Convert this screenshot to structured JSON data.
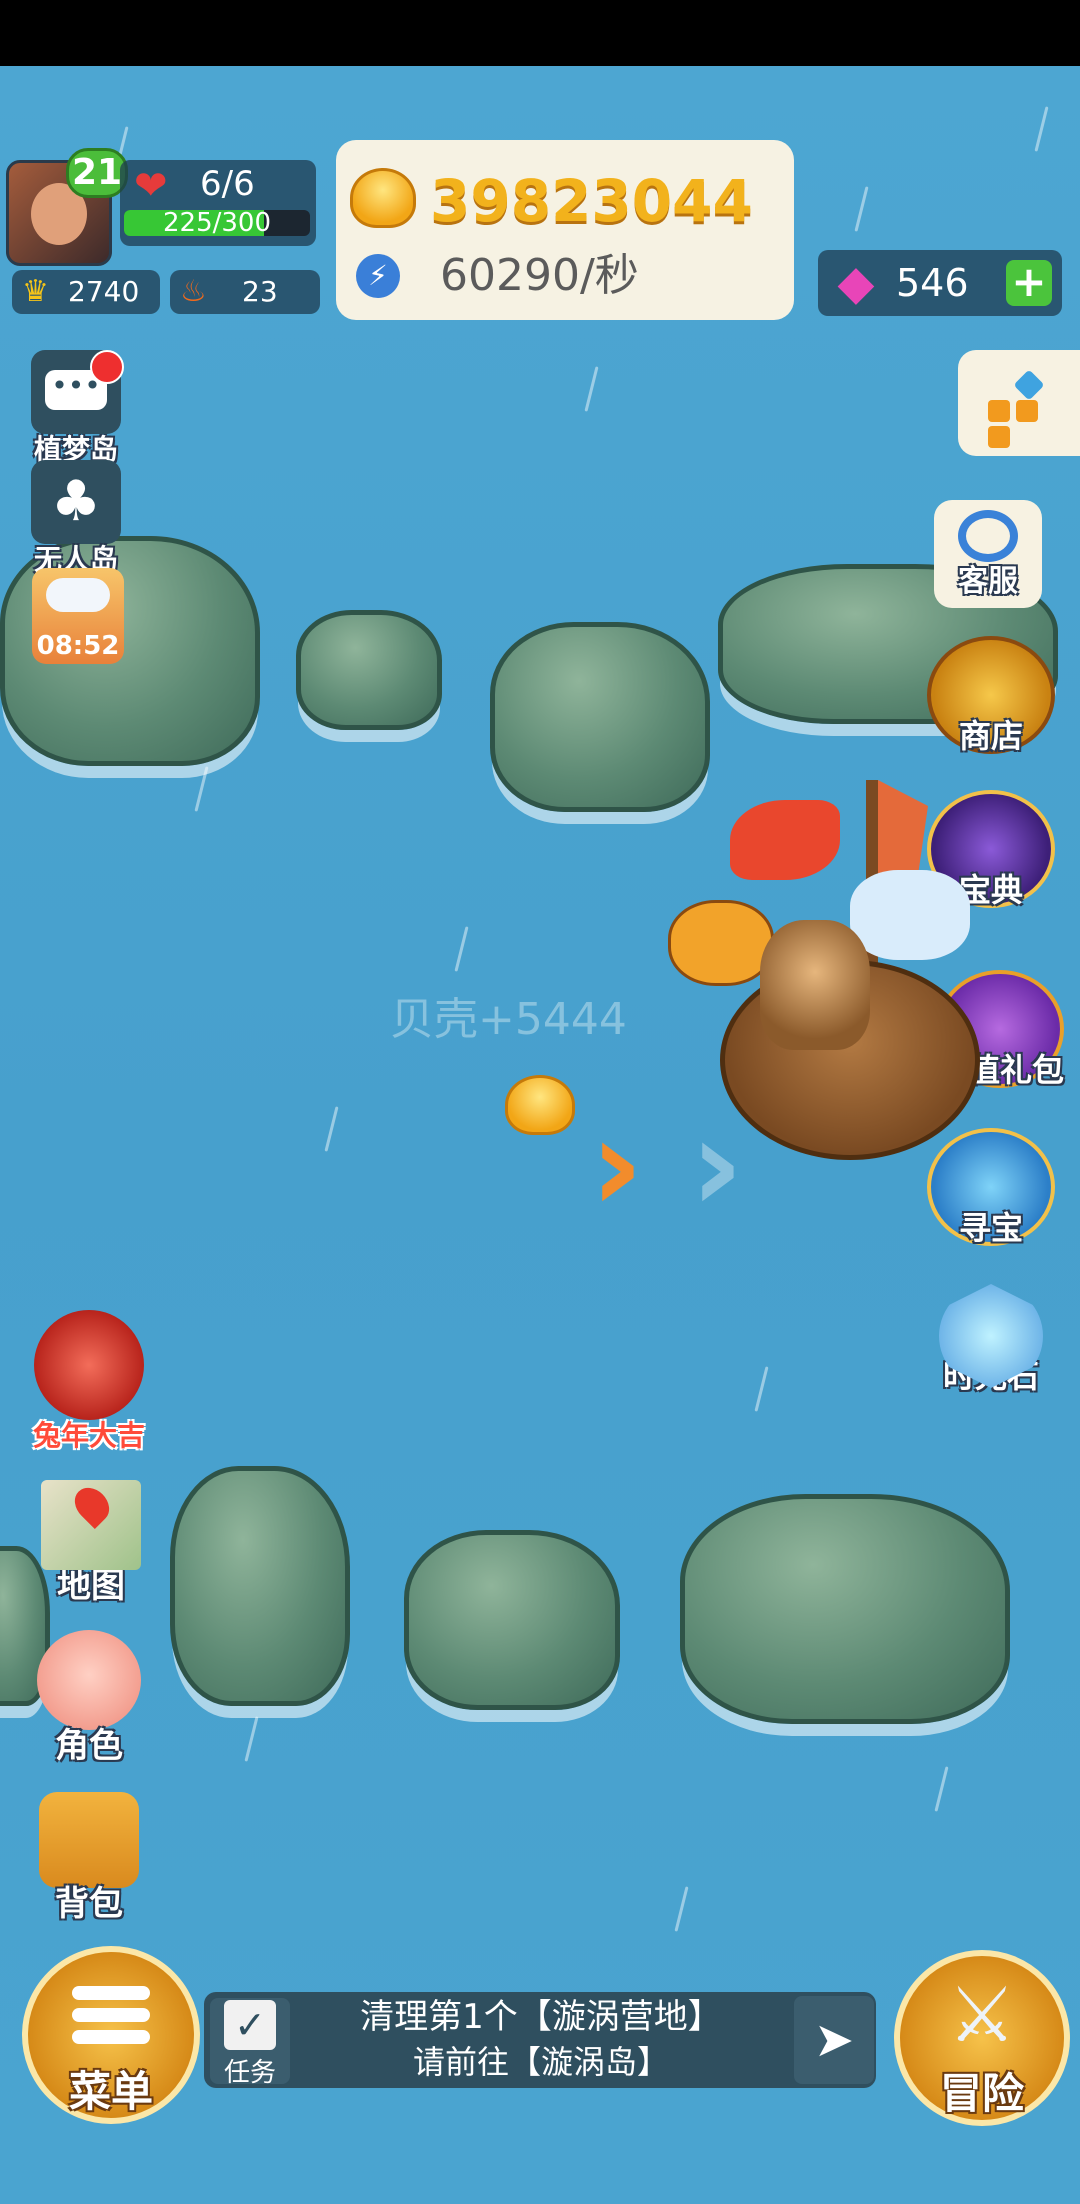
{
  "player": {
    "level": "21",
    "hp": "6/6",
    "exp_text": "225/300",
    "exp_fraction": 0.75,
    "crowns": "2740",
    "fire": "23"
  },
  "currency": {
    "coins": "39823044",
    "rate": "60290/秒",
    "gems": "546",
    "gem_add": "+"
  },
  "left_menu": {
    "dream_island": "植梦岛",
    "uninhabited_island": "无人岛",
    "weather_timer": "08:52",
    "rabbit_event": "兔年大吉",
    "map": "地图",
    "character": "角色",
    "backpack": "背包"
  },
  "right_menu": {
    "service": "客服",
    "shop": "商店",
    "codex": "宝典",
    "gift_pack": "超值礼包",
    "treasure": "寻宝",
    "time_stone": "时光石"
  },
  "scene": {
    "floating_reward": "贝壳+5444"
  },
  "bottom": {
    "menu_label": "菜单",
    "task_label": "任务",
    "task_line1": "清理第1个【漩涡营地】",
    "task_line2": "请前往【漩涡岛】",
    "adventure_label": "冒险"
  },
  "colors": {
    "sea": "#4aa4d0",
    "coin_gold": "#f2b21c",
    "gem_pink": "#e845b8",
    "exp_green": "#37c735",
    "panel_cream": "#f6f2e3"
  },
  "icons": [
    "heart-icon",
    "crown-icon",
    "fire-icon",
    "coin-icon",
    "lightning-icon",
    "gem-icon",
    "plus-icon",
    "chat-icon",
    "palm-tree-icon",
    "rain-cloud-icon",
    "rabbit-icon",
    "map-icon",
    "character-face-icon",
    "backpack-icon",
    "grid-menu-icon",
    "headset-icon",
    "shop-chest-icon",
    "codex-helmet-icon",
    "gift-icon",
    "treasure-chest-icon",
    "hourglass-icon",
    "menu-icon",
    "task-clipboard-icon",
    "go-arrow-icon",
    "crossed-swords-icon",
    "shell-icon"
  ]
}
